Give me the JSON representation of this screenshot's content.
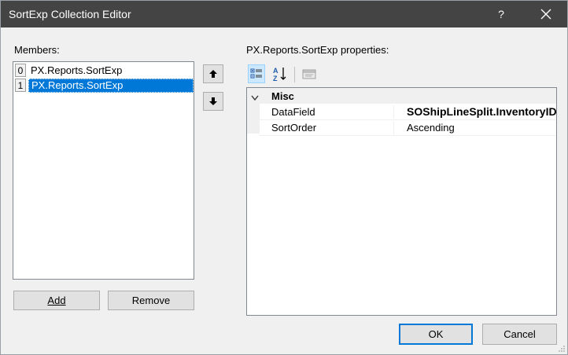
{
  "window": {
    "title": "SortExp Collection Editor",
    "help": "?",
    "close": "✕"
  },
  "members": {
    "label": "Members:",
    "items": [
      {
        "index": "0",
        "text": "PX.Reports.SortExp"
      },
      {
        "index": "1",
        "text": "PX.Reports.SortExp"
      }
    ],
    "selected_index": 1,
    "add_label": "Add",
    "remove_label": "Remove"
  },
  "properties": {
    "label": "PX.Reports.SortExp properties:",
    "category": "Misc",
    "rows": [
      {
        "name": "DataField",
        "value": "SOShipLineSplit.InventoryID"
      },
      {
        "name": "SortOrder",
        "value": "Ascending"
      }
    ]
  },
  "footer": {
    "ok_label": "OK",
    "cancel_label": "Cancel"
  },
  "icons": {
    "move_up": "arrow-up-icon",
    "move_down": "arrow-down-icon",
    "categorized": "categorized-icon",
    "alphabetical": "sort-alpha-icon",
    "property_pages": "property-pages-icon",
    "collapse": "chevron-down-icon"
  }
}
